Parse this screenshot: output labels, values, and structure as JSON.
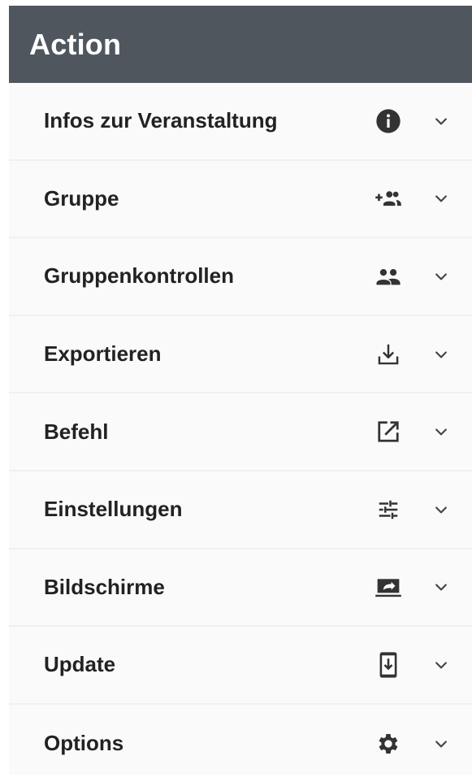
{
  "header": {
    "title": "Action"
  },
  "items": [
    {
      "label": "Infos zur Veranstaltung",
      "icon": "info-icon"
    },
    {
      "label": "Gruppe",
      "icon": "group-add-icon"
    },
    {
      "label": "Gruppenkontrollen",
      "icon": "people-icon"
    },
    {
      "label": "Exportieren",
      "icon": "download-icon"
    },
    {
      "label": "Befehl",
      "icon": "open-in-new-icon"
    },
    {
      "label": "Einstellungen",
      "icon": "tune-icon"
    },
    {
      "label": "Bildschirme",
      "icon": "screen-share-icon"
    },
    {
      "label": "Update",
      "icon": "system-update-icon"
    },
    {
      "label": "Options",
      "icon": "gear-icon"
    }
  ],
  "colors": {
    "header_bg": "#4f565e",
    "header_text": "#ffffff",
    "item_text": "#222222",
    "icon": "#333333"
  }
}
